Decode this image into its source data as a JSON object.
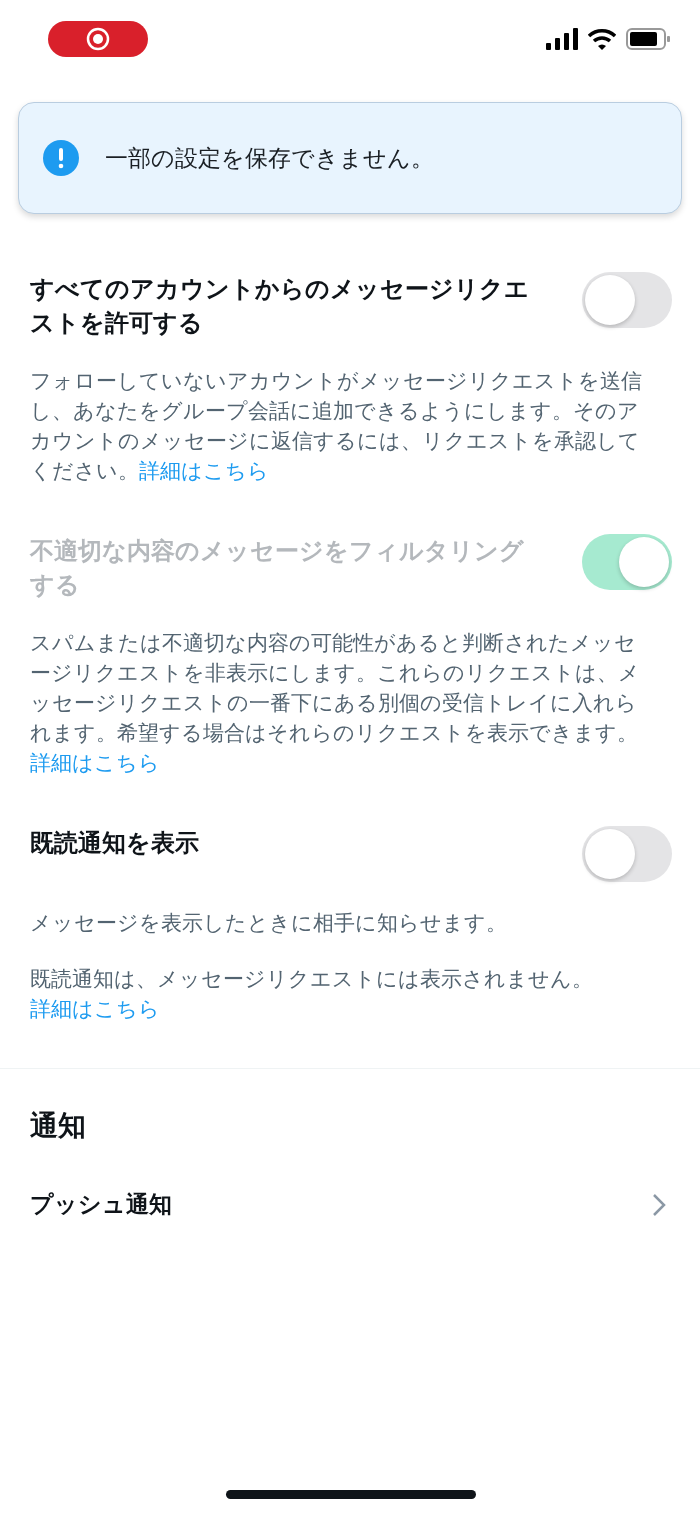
{
  "toast": {
    "message": "一部の設定を保存できません。"
  },
  "settings": [
    {
      "title": "すべてのアカウントからのメッセージリクエストを許可する",
      "on": false,
      "disabled": false,
      "paragraphs": [
        {
          "text": "フォローしていないアカウントがメッセージリクエストを送信し、あなたをグループ会話に追加できるようにします。そのアカウントのメッセージに返信するには、リクエストを承認してください。",
          "link": "詳細はこちら"
        }
      ]
    },
    {
      "title": "不適切な内容のメッセージをフィルタリングする",
      "on": true,
      "disabled": true,
      "paragraphs": [
        {
          "text": "スパムまたは不適切な内容の可能性があると判断されたメッセージリクエストを非表示にします。これらのリクエストは、メッセージリクエストの一番下にある別個の受信トレイに入れられます。希望する場合はそれらのリクエストを表示できます。",
          "link": "詳細はこちら"
        }
      ]
    },
    {
      "title": "既読通知を表示",
      "on": false,
      "disabled": false,
      "paragraphs": [
        {
          "text": "メッセージを表示したときに相手に知らせます。"
        },
        {
          "text": "既読通知は、メッセージリクエストには表示されません。",
          "link": "詳細はこちら"
        }
      ]
    }
  ],
  "notifications": {
    "heading": "通知",
    "items": [
      {
        "label": "プッシュ通知"
      }
    ]
  }
}
